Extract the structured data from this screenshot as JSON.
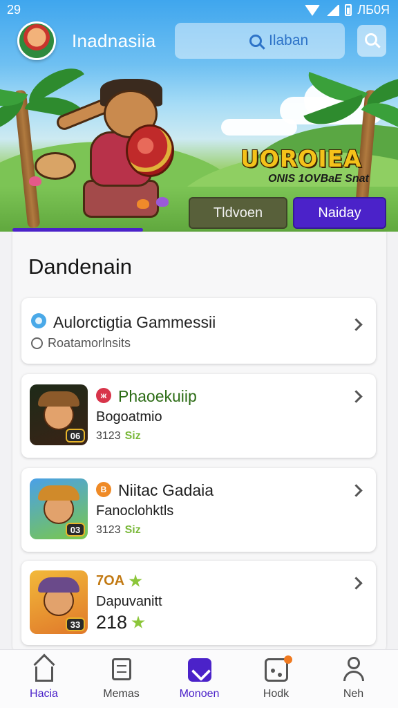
{
  "status_bar": {
    "time": "29",
    "clock": "ЛБ0Я"
  },
  "header": {
    "app_name": "Inadnasiia",
    "search_text": "Ilaban"
  },
  "banner": {
    "title": "UOROIEA",
    "subtitle": "ONIS 1OVBaE Snat",
    "tabs": [
      {
        "label": "Tldvoen",
        "active": false
      },
      {
        "label": "Naiday",
        "active": true
      }
    ],
    "progress_fraction": 0.35
  },
  "section": {
    "title": "Dandenain"
  },
  "cards": [
    {
      "title": "Aulorctigtia Gammessii",
      "subtitle": "Roatamorlnsits"
    },
    {
      "badge": "ж",
      "title": "Phaoekuiip",
      "subtitle": "Bogoatmio",
      "meta": "3123",
      "meta_icon": "Siz",
      "level": "06"
    },
    {
      "badge": "B",
      "title": "Niitac Gadaia",
      "subtitle": "Fanoclohktls",
      "meta": "3123",
      "meta_icon": "Siz",
      "level": "03"
    },
    {
      "tag": "7OA",
      "subtitle": "Dapuvanitt",
      "big_value": "218",
      "level": "33"
    }
  ],
  "bottom_nav": [
    {
      "label": "Hacia",
      "icon": "home-icon",
      "active": true
    },
    {
      "label": "Memas",
      "icon": "document-icon",
      "active": false
    },
    {
      "label": "Monoen",
      "icon": "app-icon",
      "active": true
    },
    {
      "label": "Hodk",
      "icon": "dice-icon",
      "active": false
    },
    {
      "label": "Neh",
      "icon": "profile-icon",
      "active": false
    }
  ],
  "colors": {
    "accent": "#4b22c9",
    "card1_title": "#2b6b14",
    "banner_title": "#f4c21a"
  }
}
